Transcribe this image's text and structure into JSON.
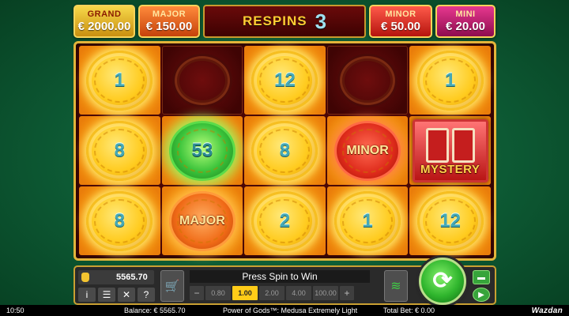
{
  "jackpots": {
    "grand": {
      "label": "GRAND",
      "value": "€ 2000.00"
    },
    "major": {
      "label": "MAJOR",
      "value": "€ 150.00"
    },
    "minor": {
      "label": "MINOR",
      "value": "€ 50.00"
    },
    "mini": {
      "label": "MINI",
      "value": "€ 20.00"
    }
  },
  "respins": {
    "label": "RESPINS",
    "count": "3"
  },
  "grid": {
    "rows": [
      [
        {
          "type": "coin",
          "value": "1"
        },
        {
          "type": "empty"
        },
        {
          "type": "coin",
          "value": "12"
        },
        {
          "type": "empty"
        },
        {
          "type": "coin",
          "value": "1"
        }
      ],
      [
        {
          "type": "coin",
          "value": "8"
        },
        {
          "type": "green-coin",
          "value": "53"
        },
        {
          "type": "coin",
          "value": "8"
        },
        {
          "type": "minor-coin",
          "value": "MINOR"
        },
        {
          "type": "mystery",
          "value": "MYSTERY"
        }
      ],
      [
        {
          "type": "coin",
          "value": "8"
        },
        {
          "type": "major-coin",
          "value": "MAJOR"
        },
        {
          "type": "coin",
          "value": "2"
        },
        {
          "type": "coin",
          "value": "1"
        },
        {
          "type": "coin",
          "value": "12"
        }
      ]
    ]
  },
  "panel": {
    "balance_value": "5565.70",
    "message": "Press Spin to Win",
    "bets": [
      "0.80",
      "1.00",
      "2.00",
      "4.00",
      "100.00"
    ],
    "active_bet": "1.00",
    "minus": "−",
    "plus": "+",
    "help": "?",
    "menu": "☰",
    "info": "i",
    "sound": "🔇"
  },
  "status_bar": {
    "time": "10:50",
    "balance": "Balance: € 5565.70",
    "game_title": "Power of Gods™: Medusa Extremely Light",
    "total_bet": "Total Bet: € 0.00",
    "brand": "Wazdan"
  },
  "icons": {
    "money": "money-bag-icon",
    "cart": "buy-feature-icon",
    "auto": "autoplay-icon",
    "spin": "spin-icon",
    "turbo": "turbo-icon",
    "play": "play-icon"
  },
  "colors": {
    "background": "#0d5a34",
    "frame": "#e3b43a",
    "active_bet": "#ffcc18",
    "spin": "#2fb52d"
  }
}
